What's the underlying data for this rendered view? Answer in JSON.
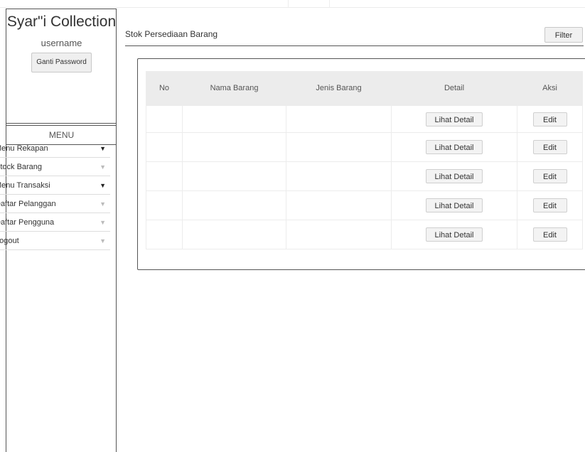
{
  "sidebar": {
    "brand": "Syar\"i Collection",
    "username": "username",
    "change_password_label": "Ganti Password",
    "menu_header": "MENU",
    "items": [
      {
        "label": "Menu Rekapan",
        "caret": "▼"
      },
      {
        "label": "Stock Barang",
        "caret": "▼"
      },
      {
        "label": "Menu Transaksi",
        "caret": "▼"
      },
      {
        "label": "Daftar Pelanggan",
        "caret": "▼"
      },
      {
        "label": "Daftar Pengguna",
        "caret": "▼"
      },
      {
        "label": "Logout",
        "caret": "▼"
      }
    ]
  },
  "main": {
    "title": "Stok Persediaan Barang",
    "filter_label": "Filter",
    "table": {
      "headers": [
        "No",
        "Nama Barang",
        "Jenis Barang",
        "Detail",
        "Aksi"
      ],
      "rows": [
        {
          "no": "",
          "nama": "",
          "jenis": "",
          "detail_label": "Lihat Detail",
          "edit_label": "Edit"
        },
        {
          "no": "",
          "nama": "",
          "jenis": "",
          "detail_label": "Lihat Detail",
          "edit_label": "Edit"
        },
        {
          "no": "",
          "nama": "",
          "jenis": "",
          "detail_label": "Lihat Detail",
          "edit_label": "Edit"
        },
        {
          "no": "",
          "nama": "",
          "jenis": "",
          "detail_label": "Lihat Detail",
          "edit_label": "Edit"
        },
        {
          "no": "",
          "nama": "",
          "jenis": "",
          "detail_label": "Lihat Detail",
          "edit_label": "Edit"
        }
      ]
    }
  }
}
